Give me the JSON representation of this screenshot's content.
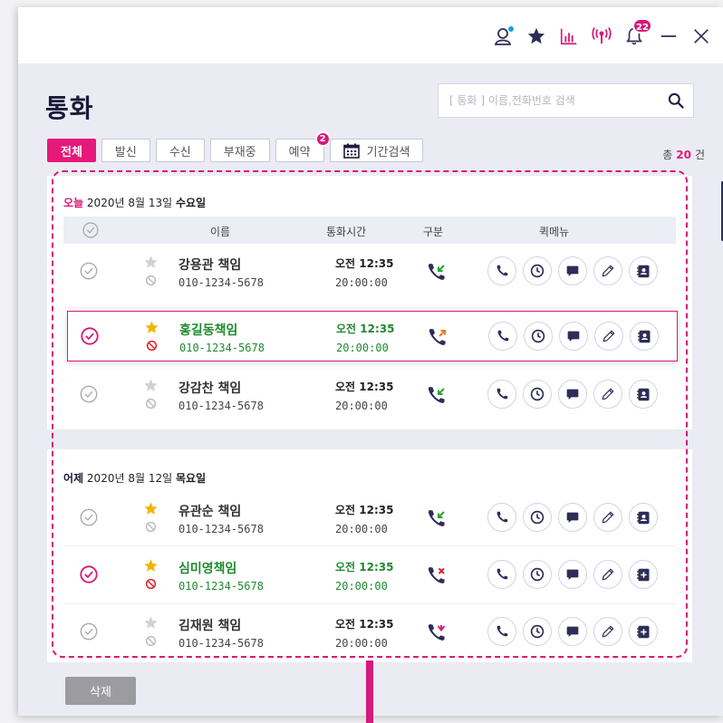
{
  "titlebar": {
    "notification_count": "22",
    "icons": [
      "profile-icon",
      "star-icon",
      "chart-icon",
      "broadcast-icon",
      "bell-icon",
      "minimize-icon",
      "close-icon"
    ]
  },
  "page": {
    "title": "통화"
  },
  "search": {
    "placeholder": "[ 통화 ] 이름,전화번호 검색",
    "value": ""
  },
  "filters": {
    "tabs": [
      {
        "label": "전체",
        "active": true
      },
      {
        "label": "발신"
      },
      {
        "label": "수신"
      },
      {
        "label": "부재중"
      },
      {
        "label": "예약",
        "badge": "2"
      },
      {
        "label": "기간검색",
        "icon": "calendar-icon"
      }
    ],
    "total_prefix": "총",
    "total_count": "20",
    "total_suffix": "건"
  },
  "columns": {
    "name": "이름",
    "time": "통화시간",
    "type": "구분",
    "quick": "퀵메뉴"
  },
  "groups": [
    {
      "relative": "오늘",
      "year": "2020",
      "year_unit": "년",
      "month": "8",
      "month_unit": "월",
      "day": "13",
      "day_unit": "일",
      "weekday": "수요일",
      "rows": [
        {
          "name": "강용관 책임",
          "phone": "010-1234-5678",
          "time": "오전 12:35",
          "duration": "20:00:00",
          "checked": false,
          "starred": false,
          "blocked": false,
          "type": "incoming"
        },
        {
          "name": "홍길동책임",
          "phone": "010-1234-5678",
          "time": "오전 12:35",
          "duration": "20:00:00",
          "checked": true,
          "starred": true,
          "blocked": true,
          "type": "outgoing"
        },
        {
          "name": "강감찬 책임",
          "phone": "010-1234-5678",
          "time": "오전 12:35",
          "duration": "20:00:00",
          "checked": false,
          "starred": false,
          "blocked": false,
          "type": "incoming"
        }
      ]
    },
    {
      "relative": "어제",
      "year": "2020",
      "year_unit": "년",
      "month": "8",
      "month_unit": "월",
      "day": "12",
      "day_unit": "일",
      "weekday": "목요일",
      "rows": [
        {
          "name": "유관순 책임",
          "phone": "010-1234-5678",
          "time": "오전 12:35",
          "duration": "20:00:00",
          "checked": false,
          "starred": true,
          "blocked": false,
          "type": "incoming"
        },
        {
          "name": "심미영책임",
          "phone": "010-1234-5678",
          "time": "오전 12:35",
          "duration": "20:00:00",
          "checked": true,
          "starred": true,
          "blocked": true,
          "type": "missed"
        },
        {
          "name": "김재원 책임",
          "phone": "010-1234-5678",
          "time": "오전 12:35",
          "duration": "20:00:00",
          "checked": false,
          "starred": false,
          "blocked": false,
          "type": "reserved"
        }
      ]
    }
  ],
  "footer": {
    "delete_label": "삭제"
  },
  "colors": {
    "accent": "#d6197a",
    "navy": "#2d2d57",
    "green": "#1f8a2e",
    "star": "#f3b400",
    "incoming": "#2aa52a",
    "outgoing": "#f07820",
    "missed": "#e0232a",
    "reserved": "#e0207a"
  }
}
